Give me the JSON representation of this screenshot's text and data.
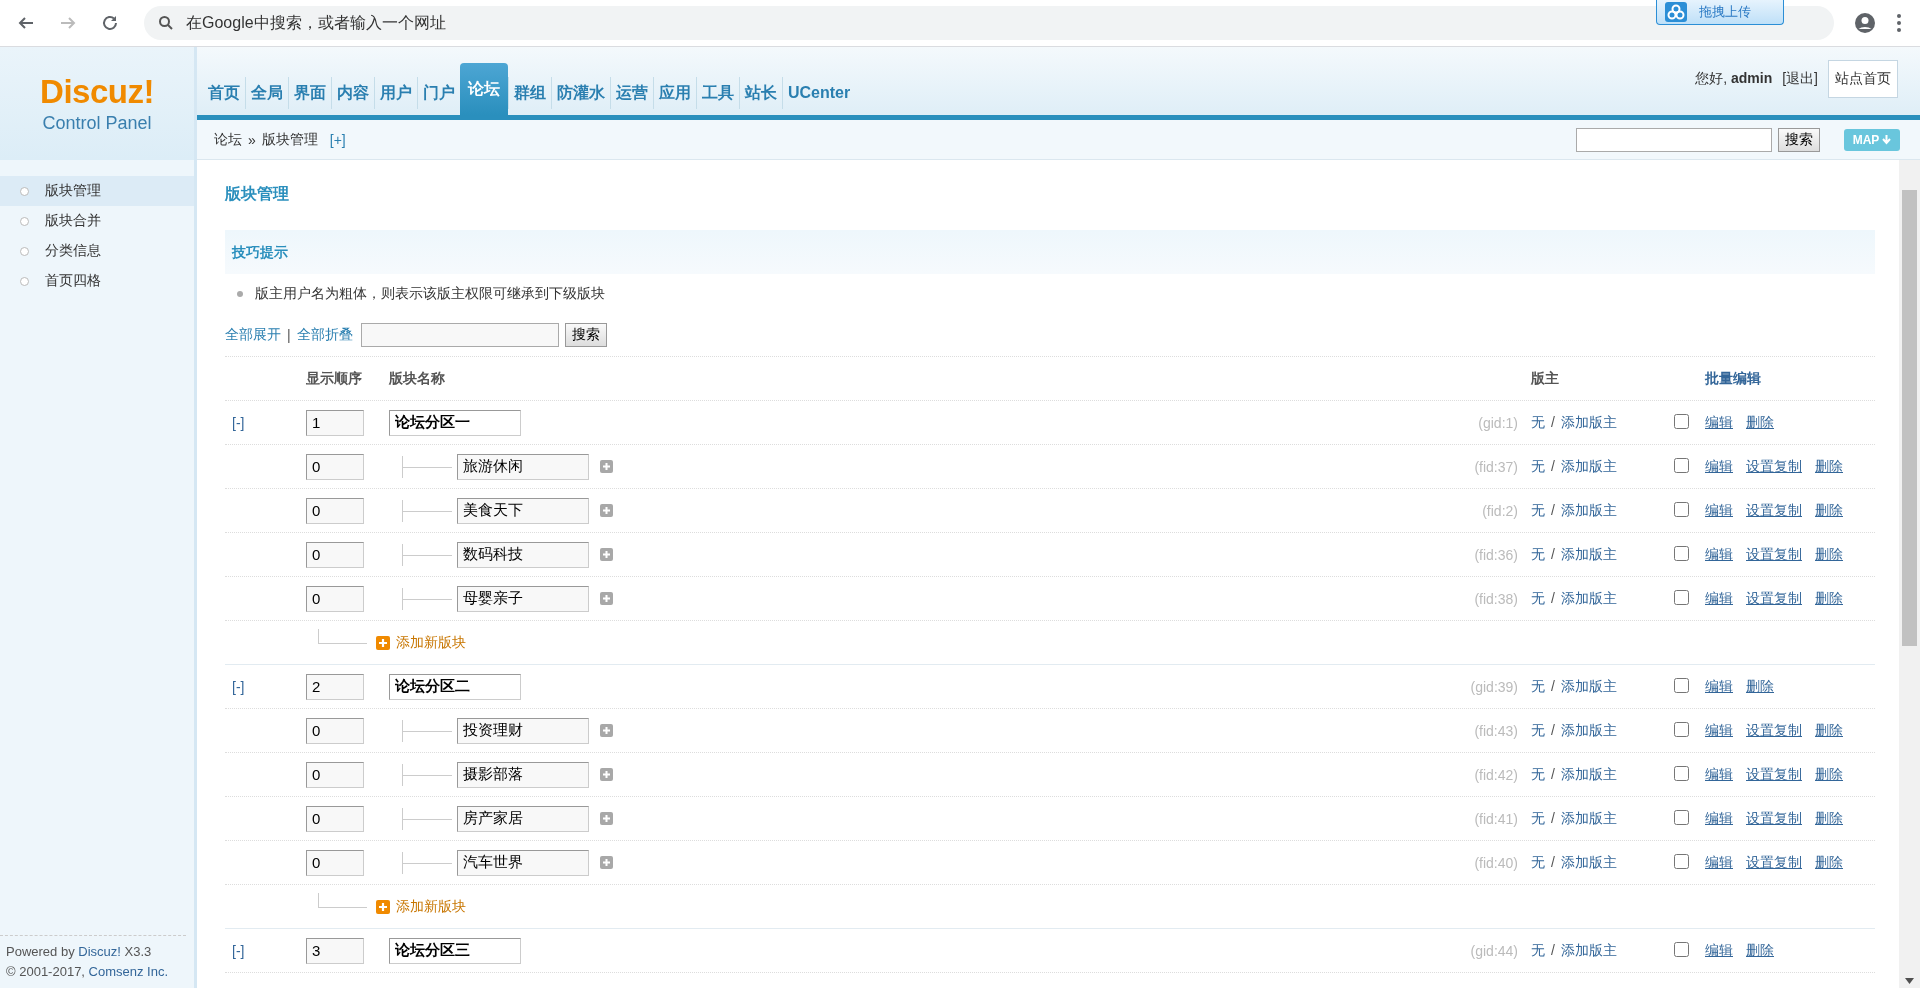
{
  "browser": {
    "nav_buttons": [
      {
        "kind": "back",
        "disabled": false
      },
      {
        "kind": "forward",
        "disabled": true
      },
      {
        "kind": "reload",
        "disabled": false
      }
    ],
    "address_placeholder": "在Google中搜索，或者输入一个网址",
    "extension_label": "拖拽上传"
  },
  "logo": {
    "title": "Discuz!",
    "subtitle": "Control Panel"
  },
  "nav": [
    {
      "label": "首页",
      "selected": false
    },
    {
      "label": "全局",
      "selected": false
    },
    {
      "label": "界面",
      "selected": false
    },
    {
      "label": "内容",
      "selected": false
    },
    {
      "label": "用户",
      "selected": false
    },
    {
      "label": "门户",
      "selected": false
    },
    {
      "label": "论坛",
      "selected": true
    },
    {
      "label": "群组",
      "selected": false
    },
    {
      "label": "防灌水",
      "selected": false
    },
    {
      "label": "运营",
      "selected": false
    },
    {
      "label": "应用",
      "selected": false
    },
    {
      "label": "工具",
      "selected": false
    },
    {
      "label": "站长",
      "selected": false
    },
    {
      "label": "UCenter",
      "selected": false
    }
  ],
  "user": {
    "greeting": "您好,",
    "name": "admin",
    "logout": "[退出]",
    "home_button": "站点首页"
  },
  "breadcrumb": {
    "items": [
      "论坛",
      "»",
      "版块管理"
    ],
    "add": "[+]",
    "search_button": "搜索",
    "map_button": "MAP"
  },
  "sidebar": {
    "items": [
      {
        "label": "版块管理",
        "selected": true
      },
      {
        "label": "版块合并",
        "selected": false
      },
      {
        "label": "分类信息",
        "selected": false
      },
      {
        "label": "首页四格",
        "selected": false
      }
    ],
    "footer": [
      {
        "before": "Powered by",
        "link": "Discuz!",
        "after": "X3.3"
      },
      {
        "before": "© 2001-2017,",
        "link": "Comsenz Inc."
      }
    ]
  },
  "main": {
    "title": "版块管理",
    "tips_title": "技巧提示",
    "tips": [
      "版主用户名为粗体，则表示该版主权限可继承到下级版块"
    ],
    "toolbar": {
      "expand": "全部展开",
      "separator": "|",
      "collapse": "全部折叠",
      "search_button": "搜索"
    },
    "columns": [
      "显示顺序",
      "版块名称",
      "版主",
      "批量编辑"
    ],
    "groups": [
      {
        "toggle": "[-]",
        "order": "1",
        "name": "论坛分区一",
        "id": "(gid:1)",
        "moderator": "无",
        "separator": "/",
        "add_moderator": "添加版主",
        "checked": false,
        "actions": [
          "编辑",
          "删除"
        ],
        "forums": [
          {
            "order": "0",
            "name": "旅游休闲",
            "id": "(fid:37)",
            "moderator": "无",
            "separator": "/",
            "add_moderator": "添加版主",
            "checked": false,
            "actions": [
              "编辑",
              "设置复制",
              "删除"
            ]
          },
          {
            "order": "0",
            "name": "美食天下",
            "id": "(fid:2)",
            "moderator": "无",
            "separator": "/",
            "add_moderator": "添加版主",
            "checked": false,
            "actions": [
              "编辑",
              "设置复制",
              "删除"
            ]
          },
          {
            "order": "0",
            "name": "数码科技",
            "id": "(fid:36)",
            "moderator": "无",
            "separator": "/",
            "add_moderator": "添加版主",
            "checked": false,
            "actions": [
              "编辑",
              "设置复制",
              "删除"
            ]
          },
          {
            "order": "0",
            "name": "母婴亲子",
            "id": "(fid:38)",
            "moderator": "无",
            "separator": "/",
            "add_moderator": "添加版主",
            "checked": false,
            "actions": [
              "编辑",
              "设置复制",
              "删除"
            ]
          }
        ],
        "add_forum": "添加新版块"
      },
      {
        "toggle": "[-]",
        "order": "2",
        "name": "论坛分区二",
        "id": "(gid:39)",
        "moderator": "无",
        "separator": "/",
        "add_moderator": "添加版主",
        "checked": false,
        "actions": [
          "编辑",
          "删除"
        ],
        "forums": [
          {
            "order": "0",
            "name": "投资理财",
            "id": "(fid:43)",
            "moderator": "无",
            "separator": "/",
            "add_moderator": "添加版主",
            "checked": false,
            "actions": [
              "编辑",
              "设置复制",
              "删除"
            ]
          },
          {
            "order": "0",
            "name": "摄影部落",
            "id": "(fid:42)",
            "moderator": "无",
            "separator": "/",
            "add_moderator": "添加版主",
            "checked": false,
            "actions": [
              "编辑",
              "设置复制",
              "删除"
            ]
          },
          {
            "order": "0",
            "name": "房产家居",
            "id": "(fid:41)",
            "moderator": "无",
            "separator": "/",
            "add_moderator": "添加版主",
            "checked": false,
            "actions": [
              "编辑",
              "设置复制",
              "删除"
            ]
          },
          {
            "order": "0",
            "name": "汽车世界",
            "id": "(fid:40)",
            "moderator": "无",
            "separator": "/",
            "add_moderator": "添加版主",
            "checked": false,
            "actions": [
              "编辑",
              "设置复制",
              "删除"
            ]
          }
        ],
        "add_forum": "添加新版块"
      },
      {
        "toggle": "[-]",
        "order": "3",
        "name": "论坛分区三",
        "id": "(gid:44)",
        "moderator": "无",
        "separator": "/",
        "add_moderator": "添加版主",
        "checked": false,
        "actions": [
          "编辑",
          "删除"
        ]
      }
    ]
  }
}
